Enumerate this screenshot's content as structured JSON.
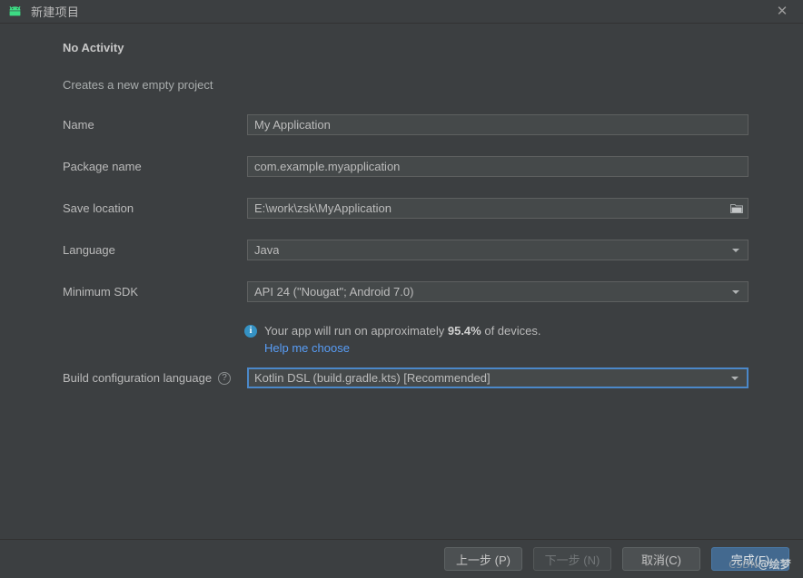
{
  "window": {
    "title": "新建项目",
    "app_icon": "android-robot-icon",
    "close_label": "✕"
  },
  "header": {
    "headline": "No Activity",
    "subline": "Creates a new empty project"
  },
  "form": {
    "fields": [
      {
        "label": "Name",
        "value": "My Application",
        "type": "text"
      },
      {
        "label": "Package name",
        "value": "com.example.myapplication",
        "type": "text"
      },
      {
        "label": "Save location",
        "value": "E:\\work\\zsk\\MyApplication",
        "type": "path"
      },
      {
        "label": "Language",
        "value": "Java",
        "type": "combo"
      },
      {
        "label": "Minimum SDK",
        "value": "API 24 (\"Nougat\"; Android 7.0)",
        "type": "combo"
      },
      {
        "label": "Build configuration language",
        "value": "Kotlin DSL (build.gradle.kts) [Recommended]",
        "type": "combo",
        "help": "?",
        "focused": true
      }
    ]
  },
  "info": {
    "icon": "info-icon",
    "text_before": "Your app will run on approximately ",
    "percent": "95.4%",
    "text_after": " of devices.",
    "link": "Help me choose"
  },
  "buttons": {
    "previous": "上一步 (P)",
    "next": "下一步 (N)",
    "cancel": "取消(C)",
    "finish": "完成(F)"
  },
  "watermark": {
    "prefix": "CSDN",
    "handle": "@绘梦"
  },
  "colors": {
    "dialog_bg": "#3c3f41",
    "field_bg": "#45494a",
    "accent": "#4b88c9",
    "link": "#589df6",
    "info": "#3592c4",
    "android_green": "#3ddc84",
    "primary_button": "#43698f"
  }
}
